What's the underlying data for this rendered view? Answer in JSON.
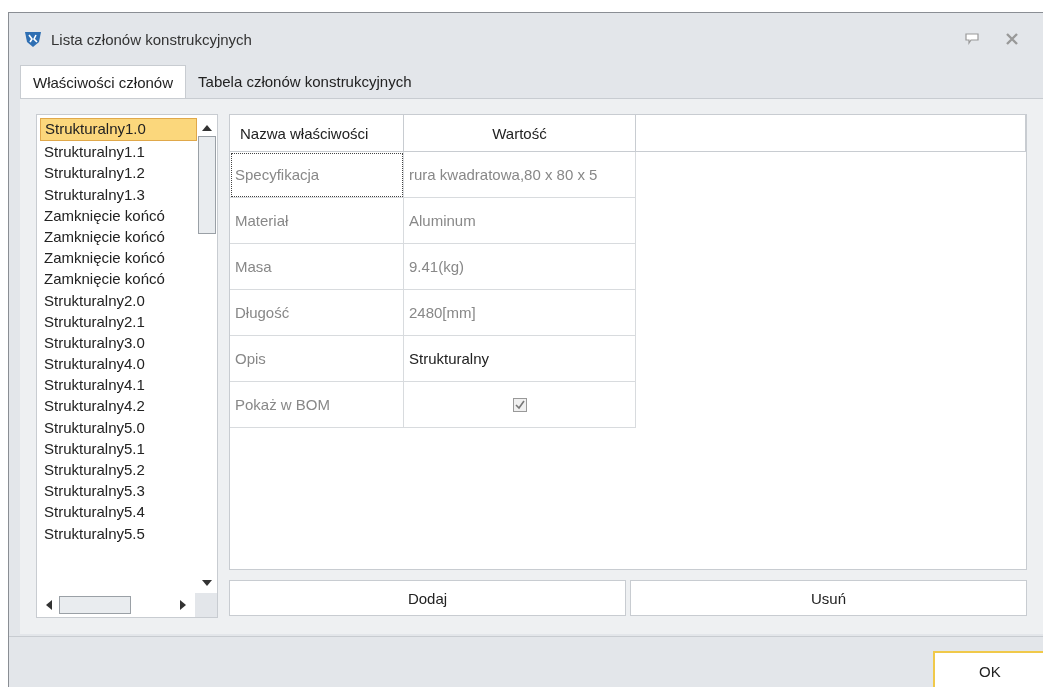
{
  "window": {
    "title": "Lista członów konstrukcyjnych"
  },
  "tabs": [
    {
      "label": "Właściwości członów",
      "selected": true
    },
    {
      "label": "Tabela członów konstrukcyjnych",
      "selected": false
    }
  ],
  "members_list": {
    "items": [
      {
        "label": "Strukturalny1.0",
        "selected": true
      },
      {
        "label": "Strukturalny1.1",
        "selected": false
      },
      {
        "label": "Strukturalny1.2",
        "selected": false
      },
      {
        "label": "Strukturalny1.3",
        "selected": false
      },
      {
        "label": "Zamknięcie końcó",
        "selected": false
      },
      {
        "label": "Zamknięcie końcó",
        "selected": false
      },
      {
        "label": "Zamknięcie końcó",
        "selected": false
      },
      {
        "label": "Zamknięcie końcó",
        "selected": false
      },
      {
        "label": "Strukturalny2.0",
        "selected": false
      },
      {
        "label": "Strukturalny2.1",
        "selected": false
      },
      {
        "label": "Strukturalny3.0",
        "selected": false
      },
      {
        "label": "Strukturalny4.0",
        "selected": false
      },
      {
        "label": "Strukturalny4.1",
        "selected": false
      },
      {
        "label": "Strukturalny4.2",
        "selected": false
      },
      {
        "label": "Strukturalny5.0",
        "selected": false
      },
      {
        "label": "Strukturalny5.1",
        "selected": false
      },
      {
        "label": "Strukturalny5.2",
        "selected": false
      },
      {
        "label": "Strukturalny5.3",
        "selected": false
      },
      {
        "label": "Strukturalny5.4",
        "selected": false
      },
      {
        "label": "Strukturalny5.5",
        "selected": false
      }
    ]
  },
  "property_grid": {
    "columns": [
      "Nazwa właściwości",
      "Wartość"
    ],
    "rows": [
      {
        "kind": "text",
        "name": "Specyfikacja",
        "value": "rura kwadratowa,80 x 80 x 5",
        "readonly": true
      },
      {
        "kind": "text",
        "name": "Materiał",
        "value": "Aluminum",
        "readonly": true
      },
      {
        "kind": "text",
        "name": "Masa",
        "value": "9.41(kg)",
        "readonly": true
      },
      {
        "kind": "text",
        "name": "Długość",
        "value": "2480[mm]",
        "readonly": true
      },
      {
        "kind": "text",
        "name": "Opis",
        "value": "Strukturalny",
        "readonly": false
      },
      {
        "kind": "checkbox",
        "name": "Pokaż w BOM",
        "checked": true,
        "readonly": true
      }
    ]
  },
  "buttons": [
    "Dodaj",
    "Usuń"
  ],
  "footer_buttons": [
    "OK"
  ]
}
